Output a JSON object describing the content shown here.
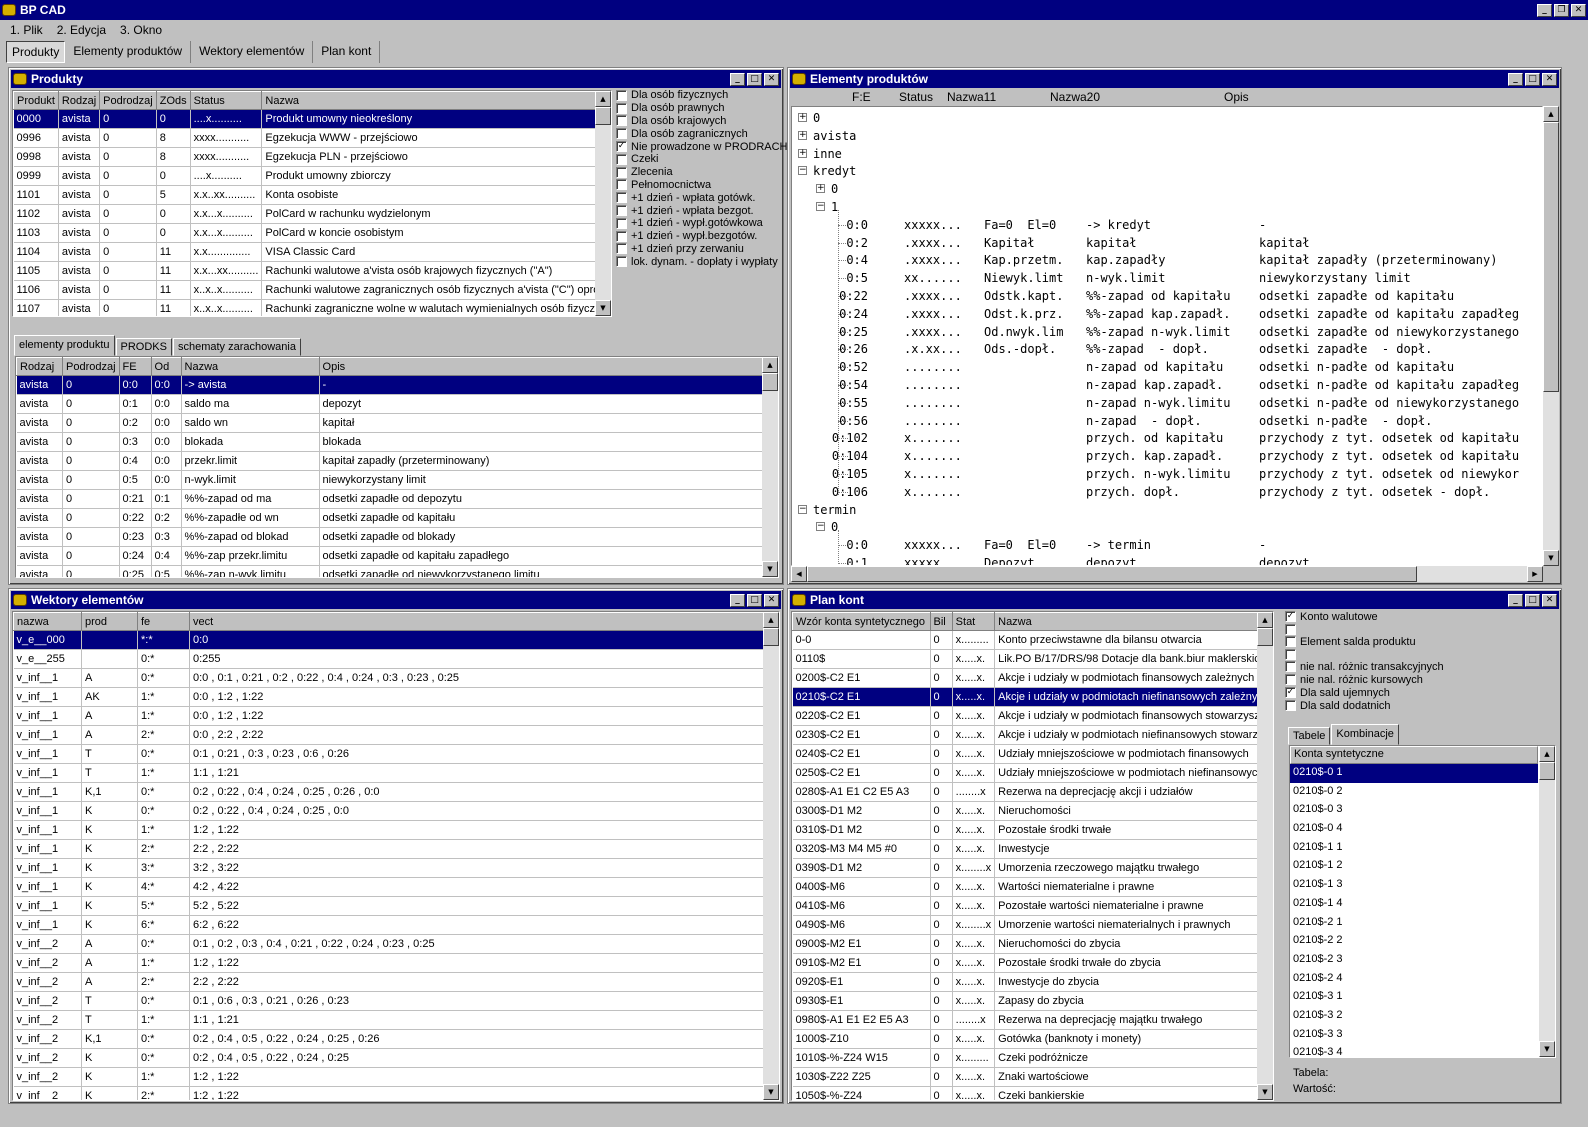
{
  "app": {
    "title": "BP CAD"
  },
  "menu": [
    {
      "label": "1. Plik"
    },
    {
      "label": "2. Edycja"
    },
    {
      "label": "3. Okno"
    }
  ],
  "toolbar_tabs": [
    {
      "label": "Produkty"
    },
    {
      "label": "Elementy produktów"
    },
    {
      "label": "Wektory elementów"
    },
    {
      "label": "Plan kont"
    }
  ],
  "produkty": {
    "title": "Produkty",
    "columns": [
      "Produkt",
      "Rodzaj",
      "Podrodzaj",
      "ZOds",
      "Status",
      "Nazwa"
    ],
    "rows": [
      [
        "0000",
        "avista",
        "0",
        "0",
        "....x..........",
        "Produkt umowny nieokreślony"
      ],
      [
        "0996",
        "avista",
        "0",
        "8",
        "xxxx...........",
        "Egzekucja WWW - przejściowo"
      ],
      [
        "0998",
        "avista",
        "0",
        "8",
        "xxxx...........",
        "Egzekucja PLN - przejściowo"
      ],
      [
        "0999",
        "avista",
        "0",
        "0",
        "....x..........",
        "Produkt umowny zbiorczy"
      ],
      [
        "1101",
        "avista",
        "0",
        "5",
        "x.x..xx..........",
        "Konta osobiste"
      ],
      [
        "1102",
        "avista",
        "0",
        "0",
        "x.x...x..........",
        "PolCard w rachunku wydzielonym"
      ],
      [
        "1103",
        "avista",
        "0",
        "0",
        "x.x...x..........",
        "PolCard w koncie osobistym"
      ],
      [
        "1104",
        "avista",
        "0",
        "11",
        "x.x..............",
        "VISA Classic Card"
      ],
      [
        "1105",
        "avista",
        "0",
        "11",
        "x.x...xx..........",
        "Rachunki walutowe a'vista osób krajowych fizycznych (\"A\")"
      ],
      [
        "1106",
        "avista",
        "0",
        "11",
        "x..x..x..........",
        "Rachunki walutowe zagranicznych osób fizycznych a'vista (\"C\") oprocen"
      ],
      [
        "1107",
        "avista",
        "0",
        "11",
        "x..x..x..........",
        "Rachunki zagraniczne wolne w walutach wymienialnych osób fizycznych"
      ]
    ],
    "checkboxes": [
      {
        "label": "Dla osób fizycznych",
        "mark": ""
      },
      {
        "label": "Dla osób prawnych",
        "mark": ""
      },
      {
        "label": "Dla osób krajowych",
        "mark": ""
      },
      {
        "label": "Dla osób zagranicznych",
        "mark": ""
      },
      {
        "label": "Nie prowadzone w PRODRACH",
        "mark": "✓"
      },
      {
        "label": "Czeki",
        "mark": ""
      },
      {
        "label": "Zlecenia",
        "mark": ""
      },
      {
        "label": "Pełnomocnictwa",
        "mark": ""
      },
      {
        "label": "+1 dzień - wpłata gotówk.",
        "mark": ""
      },
      {
        "label": "+1 dzień - wpłata bezgot.",
        "mark": ""
      },
      {
        "label": "+1 dzień - wypł.gotówkowa",
        "mark": ""
      },
      {
        "label": "+1 dzień - wypł.bezgotów.",
        "mark": ""
      },
      {
        "label": "+1 dzień przy zerwaniu",
        "mark": ""
      },
      {
        "label": "lok. dynam. - dopłaty i wypłaty",
        "mark": ""
      }
    ],
    "subtabs": [
      {
        "label": "elementy produktu"
      },
      {
        "label": "PRODKS"
      },
      {
        "label": "schematy zarachowania"
      }
    ],
    "sub_columns": [
      "Rodzaj",
      "Podrodzaj",
      "FE",
      "Od",
      "Nazwa",
      "Opis"
    ],
    "sub_rows": [
      [
        "avista",
        "0",
        "0:0",
        "0:0",
        "-> avista",
        "-"
      ],
      [
        "avista",
        "0",
        "0:1",
        "0:0",
        "saldo ma",
        "depozyt"
      ],
      [
        "avista",
        "0",
        "0:2",
        "0:0",
        "saldo wn",
        "kapitał"
      ],
      [
        "avista",
        "0",
        "0:3",
        "0:0",
        "blokada",
        "blokada"
      ],
      [
        "avista",
        "0",
        "0:4",
        "0:0",
        "przekr.limit",
        "kapitał zapadły (przeterminowany)"
      ],
      [
        "avista",
        "0",
        "0:5",
        "0:0",
        "n-wyk.limit",
        "niewykorzystany limit"
      ],
      [
        "avista",
        "0",
        "0:21",
        "0:1",
        "%%-zapad od ma",
        "odsetki zapadłe od depozytu"
      ],
      [
        "avista",
        "0",
        "0:22",
        "0:2",
        "%%-zapadłe od wn",
        "odsetki zapadłe od kapitału"
      ],
      [
        "avista",
        "0",
        "0:23",
        "0:3",
        "%%-zapad od blokad",
        "odsetki zapadłe od blokady"
      ],
      [
        "avista",
        "0",
        "0:24",
        "0:4",
        "%%-zap przekr.limitu",
        "odsetki zapadłe od kapitału zapadłego"
      ],
      [
        "avista",
        "0",
        "0:25",
        "0:5",
        "%%-zap n-wyk.limitu",
        "odsetki zapadłe od niewykorzystanego limitu"
      ]
    ]
  },
  "elementy": {
    "title": "Elementy produktów",
    "columns": [
      "F:E",
      "Status",
      "Nazwa11",
      "Nazwa20",
      "Opis"
    ],
    "tree_nodes": [
      {
        "label": "0",
        "level": 0,
        "mark": "+"
      },
      {
        "label": "avista",
        "level": 0,
        "mark": "+"
      },
      {
        "label": "inne",
        "level": 0,
        "mark": "+"
      },
      {
        "label": "kredyt",
        "level": 0,
        "mark": "−"
      },
      {
        "label": "0",
        "level": 1,
        "mark": "+"
      },
      {
        "label": "1",
        "level": 1,
        "mark": "−"
      }
    ],
    "leaves_kredyt": [
      {
        "fe": "0:0",
        "st": "xxxxx...",
        "n11": "Fa=0  El=0",
        "n20": "-> kredyt",
        "op": "-"
      },
      {
        "fe": "0:2",
        "st": ".xxxx...",
        "n11": "Kapitał",
        "n20": "kapitał",
        "op": "kapitał"
      },
      {
        "fe": "0:4",
        "st": ".xxxx...",
        "n11": "Kap.przetm.",
        "n20": "kap.zapadły",
        "op": "kapitał zapadły (przeterminowany)"
      },
      {
        "fe": "0:5",
        "st": "xx......",
        "n11": "Niewyk.limt",
        "n20": "n-wyk.limit",
        "op": "niewykorzystany limit"
      },
      {
        "fe": "0:22",
        "st": ".xxxx...",
        "n11": "Odstk.kapt.",
        "n20": "%%-zapad od kapitału",
        "op": "odsetki zapadłe od kapitału"
      },
      {
        "fe": "0:24",
        "st": ".xxxx...",
        "n11": "Odst.k.prz.",
        "n20": "%%-zapad kap.zapadł.",
        "op": "odsetki zapadłe od kapitału zapadłeg"
      },
      {
        "fe": "0:25",
        "st": ".xxxx...",
        "n11": "Od.nwyk.lim",
        "n20": "%%-zapad n-wyk.limit",
        "op": "odsetki zapadłe od niewykorzystanego"
      },
      {
        "fe": "0:26",
        "st": ".x.xx...",
        "n11": "Ods.-dopł.",
        "n20": "%%-zapad  - dopł.",
        "op": "odsetki zapadłe  - dopł."
      },
      {
        "fe": "0:52",
        "st": "........",
        "n11": "",
        "n20": "n-zapad od kapitału",
        "op": "odsetki n-padłe od kapitału"
      },
      {
        "fe": "0:54",
        "st": "........",
        "n11": "",
        "n20": "n-zapad kap.zapadł.",
        "op": "odsetki n-padłe od kapitału zapadłeg"
      },
      {
        "fe": "0:55",
        "st": "........",
        "n11": "",
        "n20": "n-zapad n-wyk.limitu",
        "op": "odsetki n-padłe od niewykorzystanego"
      },
      {
        "fe": "0:56",
        "st": "........",
        "n11": "",
        "n20": "n-zapad  - dopł.",
        "op": "odsetki n-padłe  - dopł."
      },
      {
        "fe": "0:102",
        "st": "x.......",
        "n11": "",
        "n20": "przych. od kapitału",
        "op": "przychody z tyt. odsetek od kapitału"
      },
      {
        "fe": "0:104",
        "st": "x.......",
        "n11": "",
        "n20": "przych. kap.zapadł.",
        "op": "przychody z tyt. odsetek od kapitału"
      },
      {
        "fe": "0:105",
        "st": "x.......",
        "n11": "",
        "n20": "przych. n-wyk.limitu",
        "op": "przychody z tyt. odsetek od niewykor"
      },
      {
        "fe": "0:106",
        "st": "x.......",
        "n11": "",
        "n20": "przych. dopł.",
        "op": "przychody z tyt. odsetek - dopł."
      }
    ],
    "termin_nodes": [
      {
        "label": "termin",
        "mark": "−"
      },
      {
        "label": "0",
        "mark": "−"
      }
    ],
    "leaves_termin": [
      {
        "fe": "0:0",
        "st": "xxxxx...",
        "n11": "Fa=0  El=0",
        "n20": "-> termin",
        "op": "-"
      },
      {
        "fe": "0:1",
        "st": "xxxxx...",
        "n11": "Depozyt",
        "n20": "depozyt",
        "op": "depozyt"
      }
    ]
  },
  "wektory": {
    "title": "Wektory elementów",
    "columns": [
      "nazwa",
      "prod",
      "fe",
      "vect"
    ],
    "rows": [
      [
        "v_e__000",
        "",
        "*:*",
        "0:0"
      ],
      [
        "v_e__255",
        "",
        "0:*",
        "0:255"
      ],
      [
        "v_inf__1",
        "A",
        "0:*",
        "0:0  , 0:1  , 0:21 , 0:2  , 0:22 , 0:4  , 0:24 , 0:3  , 0:23 , 0:25"
      ],
      [
        "v_inf__1",
        "AK",
        "1:*",
        "0:0  , 1:2  , 1:22"
      ],
      [
        "v_inf__1",
        "A",
        "1:*",
        "0:0  , 1:2  , 1:22"
      ],
      [
        "v_inf__1",
        "A",
        "2:*",
        "0:0  , 2:2  , 2:22"
      ],
      [
        "v_inf__1",
        "T",
        "0:*",
        "0:1  , 0:21 , 0:3  , 0:23 , 0:6  , 0:26"
      ],
      [
        "v_inf__1",
        "T",
        "1:*",
        "1:1  , 1:21"
      ],
      [
        "v_inf__1",
        "K,1",
        "0:*",
        "0:2  , 0:22 , 0:4  , 0:24 , 0:25 , 0:26 , 0:0"
      ],
      [
        "v_inf__1",
        "K",
        "0:*",
        "0:2  , 0:22 , 0:4  , 0:24 , 0:25 , 0:0"
      ],
      [
        "v_inf__1",
        "K",
        "1:*",
        "1:2  , 1:22"
      ],
      [
        "v_inf__1",
        "K",
        "2:*",
        "2:2  , 2:22"
      ],
      [
        "v_inf__1",
        "K",
        "3:*",
        "3:2  , 3:22"
      ],
      [
        "v_inf__1",
        "K",
        "4:*",
        "4:2  , 4:22"
      ],
      [
        "v_inf__1",
        "K",
        "5:*",
        "5:2  , 5:22"
      ],
      [
        "v_inf__1",
        "K",
        "6:*",
        "6:2  , 6:22"
      ],
      [
        "v_inf__2",
        "A",
        "0:*",
        "0:1  , 0:2  , 0:3  , 0:4  , 0:21 , 0:22 , 0:24 , 0:23 , 0:25"
      ],
      [
        "v_inf__2",
        "A",
        "1:*",
        "1:2  , 1:22"
      ],
      [
        "v_inf__2",
        "A",
        "2:*",
        "2:2  , 2:22"
      ],
      [
        "v_inf__2",
        "T",
        "0:*",
        "0:1  , 0:6  , 0:3  , 0:21 , 0:26 , 0:23"
      ],
      [
        "v_inf__2",
        "T",
        "1:*",
        "1:1  , 1:21"
      ],
      [
        "v_inf__2",
        "K,1",
        "0:*",
        "0:2  , 0:4  , 0:5  , 0:22 , 0:24 , 0:25 , 0:26"
      ],
      [
        "v_inf__2",
        "K",
        "0:*",
        "0:2  , 0:4  , 0:5  , 0:22 , 0:24 , 0:25"
      ],
      [
        "v_inf__2",
        "K",
        "1:*",
        "1:2  , 1:22"
      ],
      [
        "v_inf__2",
        "K",
        "2:*",
        "1:2  , 1:22"
      ]
    ]
  },
  "plan": {
    "title": "Plan kont",
    "columns": [
      "Wzór konta syntetycznego",
      "Bil",
      "Stat",
      "Nazwa"
    ],
    "rows": [
      [
        "0-0",
        "0",
        "x.........",
        "Konto przeciwstawne dla bilansu otwarcia"
      ],
      [
        "0110$",
        "0",
        "x.....x.",
        "Lik.PO B/17/DRS/98 Dotacje dla bank.biur maklerskich"
      ],
      [
        "0200$-C2 E1",
        "0",
        "x.....x.",
        "Akcje i udziały w podmiotach finansowych zależnych"
      ],
      [
        "0210$-C2 E1",
        "0",
        "x.....x.",
        "Akcje i udziały w podmiotach niefinansowych zależnych"
      ],
      [
        "0220$-C2 E1",
        "0",
        "x.....x.",
        "Akcje i udziały w podmiotach finansowych stowarzysz."
      ],
      [
        "0230$-C2 E1",
        "0",
        "x.....x.",
        "Akcje i udziały w podmiotach niefinansowych stowarz."
      ],
      [
        "0240$-C2 E1",
        "0",
        "x.....x.",
        "Udziały mniejszościowe w podmiotach finansowych"
      ],
      [
        "0250$-C2 E1",
        "0",
        "x.....x.",
        "Udziały mniejszościowe w podmiotach niefinansowych"
      ],
      [
        "0280$-A1 E1 C2 E5 A3",
        "0",
        "........x",
        "Rezerwa na deprecjację akcji i udziałów"
      ],
      [
        "0300$-D1 M2",
        "0",
        "x.....x.",
        "Nieruchomości"
      ],
      [
        "0310$-D1 M2",
        "0",
        "x.....x.",
        "Pozostałe środki trwałe"
      ],
      [
        "0320$-M3 M4 M5 #0",
        "0",
        "x.....x.",
        "Inwestycje"
      ],
      [
        "0390$-D1 M2",
        "0",
        "x........x",
        "Umorzenia rzeczowego majątku trwałego"
      ],
      [
        "0400$-M6",
        "0",
        "x.....x.",
        "Wartości niematerialne i prawne"
      ],
      [
        "0410$-M6",
        "0",
        "x.....x.",
        "Pozostałe wartości niematerialne i prawne"
      ],
      [
        "0490$-M6",
        "0",
        "x........x",
        "Umorzenie wartości niematerialnych i prawnych"
      ],
      [
        "0900$-M2 E1",
        "0",
        "x.....x.",
        "Nieruchomości do zbycia"
      ],
      [
        "0910$-M2 E1",
        "0",
        "x.....x.",
        "Pozostałe środki trwałe do zbycia"
      ],
      [
        "0920$-E1",
        "0",
        "x.....x.",
        "Inwestycje do zbycia"
      ],
      [
        "0930$-E1",
        "0",
        "x.....x.",
        "Zapasy do zbycia"
      ],
      [
        "0980$-A1 E1 E2 E5 A3",
        "0",
        "........x",
        "Rezerwa na deprecjację majątku trwałego"
      ],
      [
        "1000$-Z10",
        "0",
        "x.....x.",
        "Gotówka  (banknoty i monety)"
      ],
      [
        "1010$-%-Z24 W15",
        "0",
        "x.........",
        "Czeki podróżnicze"
      ],
      [
        "1030$-Z22 Z25",
        "0",
        "x.....x.",
        "Znaki wartościowe"
      ],
      [
        "1050$-%-Z24",
        "0",
        "x.....x.",
        "Czeki bankierskie"
      ]
    ],
    "checkboxes": [
      {
        "label": "Konto walutowe",
        "mark": "✓"
      },
      {
        "label": "",
        "mark": ""
      },
      {
        "label": "Element salda produktu",
        "mark": ""
      },
      {
        "label": "",
        "mark": ""
      },
      {
        "label": "nie nal. różnic transakcyjnych",
        "mark": ""
      },
      {
        "label": "nie nal. różnic kursowych",
        "mark": ""
      },
      {
        "label": "Dla sald ujemnych",
        "mark": "✓"
      },
      {
        "label": "Dla sald dodatnich",
        "mark": ""
      }
    ],
    "subtabs": [
      {
        "label": "Tabele"
      },
      {
        "label": "Kombinacje"
      }
    ],
    "konta_header": "Konta syntetyczne",
    "konta": [
      "0210$-0 1",
      "0210$-0 2",
      "0210$-0 3",
      "0210$-0 4",
      "0210$-1 1",
      "0210$-1 2",
      "0210$-1 3",
      "0210$-1 4",
      "0210$-2 1",
      "0210$-2 2",
      "0210$-2 3",
      "0210$-2 4",
      "0210$-3 1",
      "0210$-3 2",
      "0210$-3 3",
      "0210$-3 4"
    ],
    "tabela_label": "Tabela:",
    "wartosc_label": "Wartość:"
  }
}
